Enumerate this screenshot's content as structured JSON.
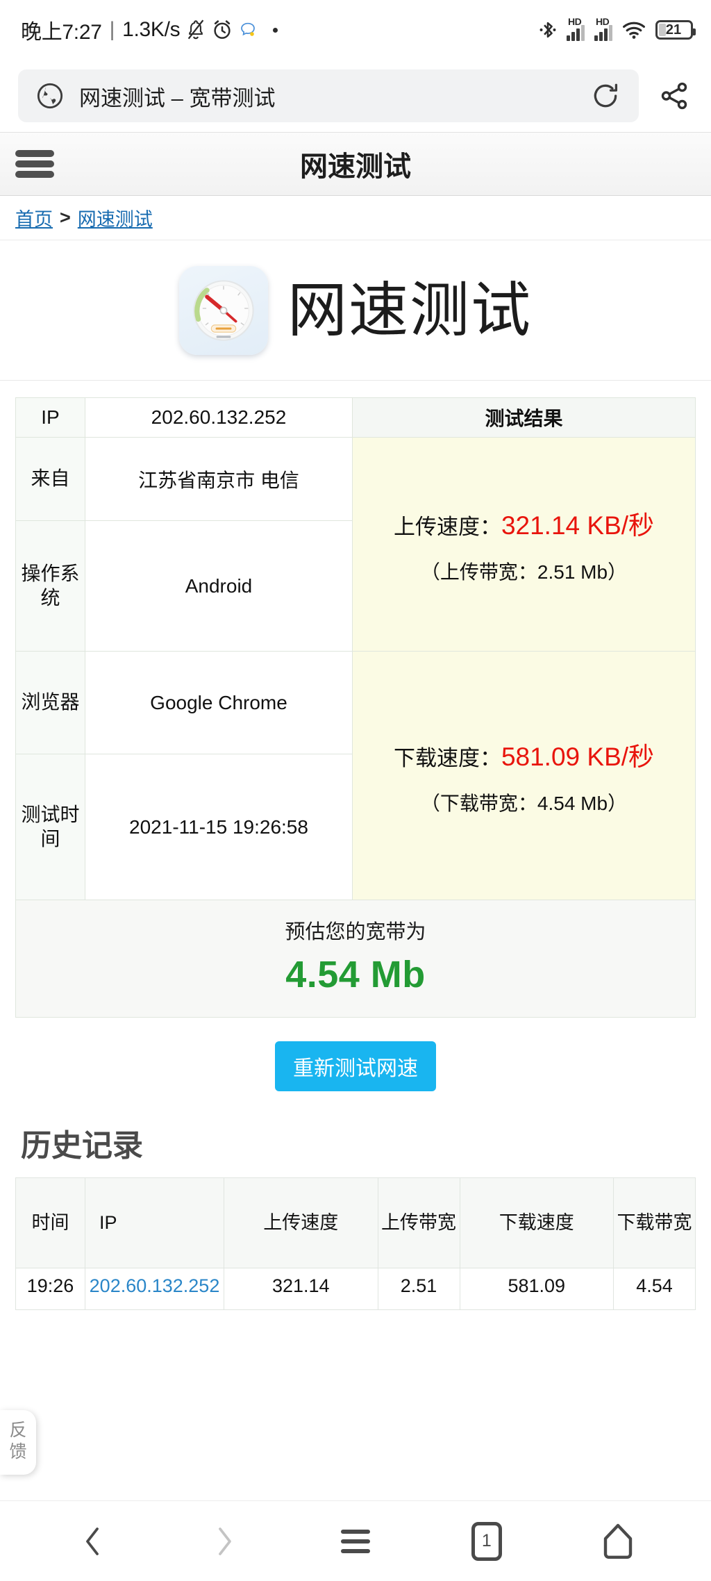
{
  "status_bar": {
    "time": "晚上7:27",
    "separator": "|",
    "net_speed": "1.3K/s",
    "icons": [
      "bell-off-icon",
      "alarm-icon",
      "chat-bubble-icon",
      "dot-icon"
    ],
    "right_icons": [
      "bluetooth-icon",
      "hd-signal-icon",
      "hd-signal-icon",
      "wifi-icon"
    ],
    "hd_label": "HD",
    "battery_level": "21"
  },
  "browser": {
    "url_title": "网速测试 – 宽带测试",
    "globe_icon": "globe-icon",
    "reload_icon": "reload-icon",
    "share_icon": "share-icon"
  },
  "site_header": {
    "title": "网速测试",
    "menu_icon": "hamburger-icon"
  },
  "breadcrumb": {
    "home": "首页",
    "separator": ">",
    "current": "网速测试"
  },
  "hero": {
    "logo_icon": "speedometer-icon",
    "title": "网速测试"
  },
  "result_table": {
    "rows": [
      {
        "label": "IP",
        "value": "202.60.132.252"
      },
      {
        "label": "来自",
        "value": "江苏省南京市 电信"
      },
      {
        "label": "操作系统",
        "value": "Android"
      },
      {
        "label": "浏览器",
        "value": "Google Chrome"
      },
      {
        "label": "测试时间",
        "value": "2021-11-15 19:26:58"
      }
    ],
    "result_header": "测试结果",
    "upload": {
      "label": "上传速度：",
      "value": "321.14 KB/秒",
      "bandwidth": "（上传带宽：2.51 Mb）"
    },
    "download": {
      "label": "下载速度：",
      "value": "581.09 KB/秒",
      "bandwidth": "（下载带宽：4.54 Mb）"
    }
  },
  "estimate": {
    "label": "预估您的宽带为",
    "value": "4.54 Mb",
    "color": "#239b34"
  },
  "retest_button": {
    "label": "重新测试网速",
    "color": "#19b5f0"
  },
  "history": {
    "title": "历史记录",
    "columns": [
      "时间",
      "IP",
      "上传速度",
      "上传带宽",
      "下载速度",
      "下载带宽"
    ],
    "rows": [
      {
        "time": "19:26",
        "ip": "202.60.132.252",
        "upload_speed": "321.14",
        "upload_bw": "2.51",
        "download_speed": "581.09",
        "download_bw": "4.54"
      }
    ]
  },
  "feedback_tab": {
    "label": "反馈"
  },
  "bottom_nav": {
    "back": "back-chevron-icon",
    "forward": "forward-chevron-icon",
    "menu": "hamburger-icon",
    "tabs_count": "1",
    "home": "home-icon"
  }
}
